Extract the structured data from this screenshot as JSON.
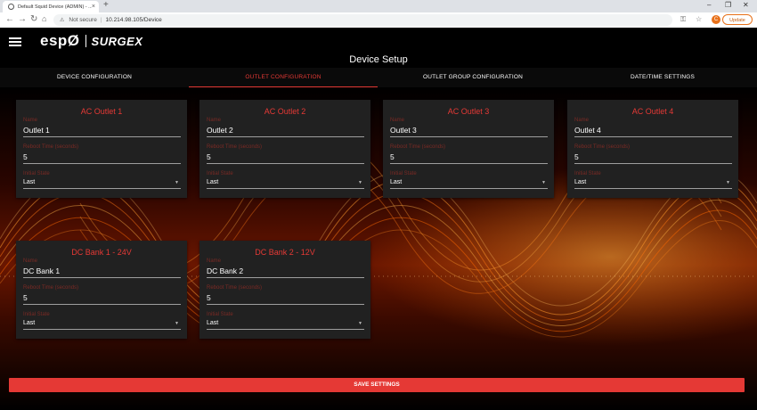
{
  "browser": {
    "tab_title": "Default Squid Device (ADMIN) - ...",
    "tab_close": "×",
    "new_tab": "+",
    "win_min": "–",
    "win_max": "❐",
    "win_close": "✕",
    "not_secure": "Not secure",
    "url": "10.214.98.105/Device",
    "profile_initial": "C",
    "update_label": "Update"
  },
  "app": {
    "logo_text": "espØ",
    "logo_brand": "SURGEX",
    "page_title": "Device Setup"
  },
  "tabs": [
    {
      "label": "DEVICE CONFIGURATION"
    },
    {
      "label": "OUTLET CONFIGURATION"
    },
    {
      "label": "OUTLET GROUP CONFIGURATION"
    },
    {
      "label": "DATE/TIME SETTINGS"
    }
  ],
  "field_labels": {
    "name": "Name",
    "reboot": "Reboot Time (seconds)",
    "initial": "Initial State"
  },
  "outlets": [
    {
      "title": "AC Outlet 1",
      "name": "Outlet 1",
      "reboot": "5",
      "initial": "Last"
    },
    {
      "title": "AC Outlet 2",
      "name": "Outlet 2",
      "reboot": "5",
      "initial": "Last"
    },
    {
      "title": "AC Outlet 3",
      "name": "Outlet 3",
      "reboot": "5",
      "initial": "Last"
    },
    {
      "title": "AC Outlet 4",
      "name": "Outlet 4",
      "reboot": "5",
      "initial": "Last"
    }
  ],
  "dc_banks": [
    {
      "title": "DC Bank 1 - 24V",
      "name": "DC Bank 1",
      "reboot": "5",
      "initial": "Last"
    },
    {
      "title": "DC Bank 2 - 12V",
      "name": "DC Bank 2",
      "reboot": "5",
      "initial": "Last"
    }
  ],
  "save_label": "SAVE SETTINGS",
  "colors": {
    "accent": "#e53935",
    "card_bg": "#212121",
    "background": "#000000"
  }
}
